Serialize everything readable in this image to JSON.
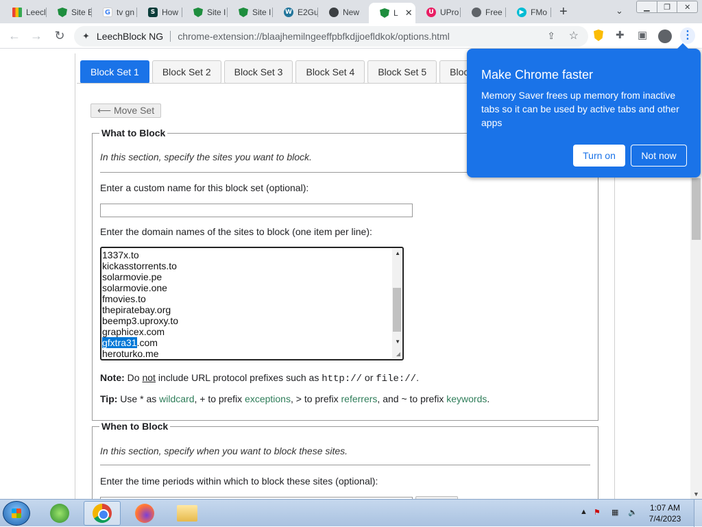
{
  "browser": {
    "tabs": [
      {
        "label": "Leecl",
        "icon": "chart-icon"
      },
      {
        "label": "Site E",
        "icon": "leechblock-icon"
      },
      {
        "label": "tv gn",
        "icon": "google-icon"
      },
      {
        "label": "How",
        "icon": "s-icon"
      },
      {
        "label": "Site I",
        "icon": "leechblock-icon"
      },
      {
        "label": "Site I",
        "icon": "leechblock-icon"
      },
      {
        "label": "E2Gu",
        "icon": "wordpress-icon"
      },
      {
        "label": "New",
        "icon": "github-icon"
      },
      {
        "label": "L",
        "icon": "leechblock-icon",
        "active": true
      },
      {
        "label": "UPro",
        "icon": "u-icon"
      },
      {
        "label": "Free",
        "icon": "globe-icon"
      },
      {
        "label": "FMo",
        "icon": "fmovies-icon"
      }
    ],
    "site_name": "LeechBlock NG",
    "url": "chrome-extension://blaajhemilngeeffpbfkdjjoefldkok/options.html"
  },
  "set_tabs": [
    "Block Set 1",
    "Block Set 2",
    "Block Set 3",
    "Block Set 4",
    "Block Set 5",
    "Block"
  ],
  "move_set": "⟵ Move Set",
  "what": {
    "legend": "What to Block",
    "intro": "In this section, specify the sites you want to block.",
    "custom_name_label": "Enter a custom name for this block set (optional):",
    "custom_name_value": "",
    "domains_label": "Enter the domain names of the sites to block (one item per line):",
    "domains": [
      "1337x.to",
      "kickasstorrents.to",
      "solarmovie.pe",
      "solarmovie.one",
      "fmovies.to",
      "thepiratebay.org",
      "beemp3.uproxy.to",
      "graphicex.com",
      "gfxtra31.com",
      "heroturko.me"
    ],
    "selected_prefix": "gfxtra31",
    "selected_suffix": ".com",
    "note_bold": "Note:",
    "note_do": "Do",
    "note_not": "not",
    "note_rest": "include URL protocol prefixes such as",
    "note_http": "http://",
    "note_or": "or",
    "note_file": "file://",
    "note_end": ".",
    "tip_bold": "Tip:",
    "tip_use": "Use",
    "tip_star": "*",
    "tip_as": "as",
    "tip_wildcard": "wildcard",
    "tip_plus": ", + to prefix",
    "tip_exceptions": "exceptions",
    "tip_gt": ", > to prefix",
    "tip_referrers": "referrers",
    "tip_tilde": ", and ~ to prefix",
    "tip_keywords": "keywords",
    "tip_end": "."
  },
  "when": {
    "legend": "When to Block",
    "intro": "In this section, specify when you want to block these sites.",
    "periods_label": "Enter the time periods within which to block these sites (optional):"
  },
  "popup": {
    "title": "Make Chrome faster",
    "body": "Memory Saver frees up memory from inactive tabs so it can be used by active tabs and other apps",
    "turn_on": "Turn on",
    "not_now": "Not now"
  },
  "taskbar": {
    "time": "1:07 AM",
    "date": "7/4/2023"
  },
  "colors": {
    "accent": "#1a73e8",
    "link_green": "#2e7d59"
  }
}
